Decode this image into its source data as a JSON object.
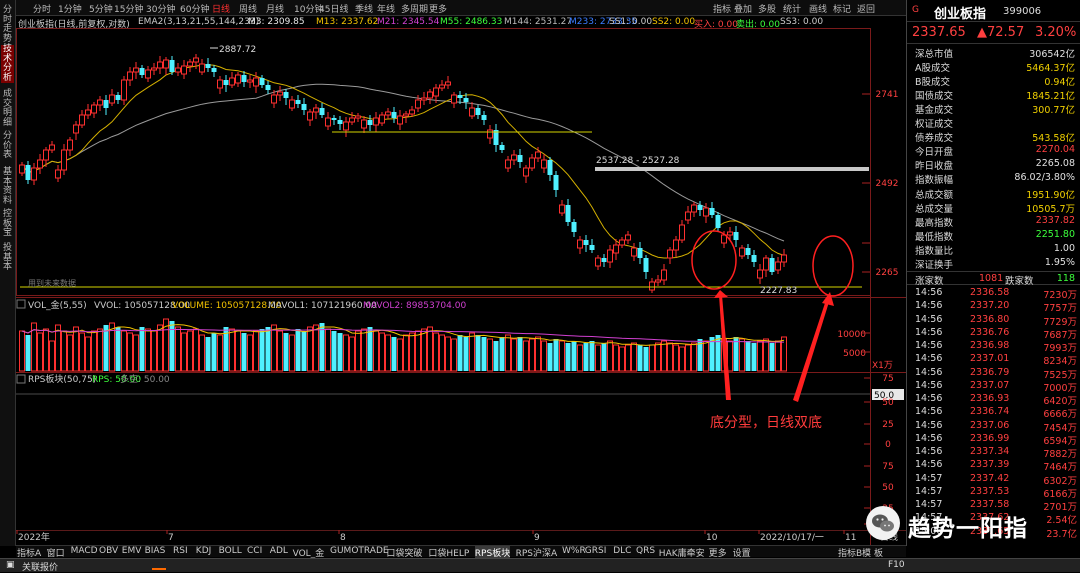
{
  "app": {
    "left_tabs": [
      "分时走势",
      "技术分析",
      "成交明细",
      "分价表",
      "基本资料",
      "控板宝",
      "投基本"
    ]
  },
  "toolbar": {
    "periods": [
      "分时",
      "1分钟",
      "5分钟",
      "15分钟",
      "30分钟",
      "60分钟",
      "日线",
      "周线",
      "月线",
      "10分钟",
      "45日线",
      "季线",
      "年线",
      "多周期",
      "更多"
    ],
    "active_period": "日线",
    "right_buttons": [
      "指标",
      "叠加",
      "多股",
      "统计",
      "画线",
      "标记",
      "返回"
    ]
  },
  "indicators": {
    "main_title": "创业板指(日线,前复权,对数)",
    "ema_label": "EMA2(3,13,21,55,144,233)",
    "m3": "M3: 2309.85",
    "m13": "M13: 2337.62",
    "m21": "M21: 2345.54",
    "m55": "M55: 2486.33",
    "m144": "M144: 2531.27",
    "m233": "M233: 2733.35",
    "ss1": "SS1: 0.00",
    "ss2": "SS2: 0.00",
    "buy": "买入: 0.00",
    "sell": "卖出: 0.00",
    "ss3": "SS3: 0.00"
  },
  "chart_labels": {
    "high": "2887.72",
    "gap": "2537.28 - 2527.28",
    "low": "2227.83",
    "future": "用到未来数据",
    "price_ticks": [
      "2741",
      "2492",
      "2265"
    ],
    "vol_title": "VOL_金(5,55)",
    "vvol": "VVOL: 105057128.00",
    "volume": "VOLUME: 105057128.00",
    "mavol1": "MAVOL1: 107121960.00",
    "mavol2": "MAVOL2: 89853704.00",
    "vol_ticks": [
      "10000",
      "5000"
    ],
    "vol_unit": "X1万",
    "rps_title": "RPS板块(50,75)",
    "rps": "RPS: 50.00",
    "rps_ms": "多空: 50.00",
    "rps_box": "50.0",
    "rps_ticks": [
      "75",
      "50",
      "25",
      "0",
      "75",
      "50",
      "25",
      "0"
    ],
    "dates": [
      "2022年",
      "7",
      "8",
      "9",
      "10",
      "2022/10/17/一",
      "11"
    ],
    "date_right": "日线"
  },
  "annotation": {
    "text": "底分型，日线双底"
  },
  "watermark": {
    "text": "趋势一阳指"
  },
  "quote": {
    "flag": "G",
    "name": "创业板指",
    "code": "399006",
    "price": "2337.65",
    "change": "▲72.57",
    "change_pct": "3.20%",
    "rows": [
      {
        "label": "深总市值",
        "value": "306542亿",
        "color": "#e0e0e0"
      },
      {
        "label": "A股成交",
        "value": "5464.37亿",
        "color": "#f0d000"
      },
      {
        "label": "B股成交",
        "value": "0.94亿",
        "color": "#f0d000"
      },
      {
        "label": "国债成交",
        "value": "1845.21亿",
        "color": "#f0d000"
      },
      {
        "label": "基金成交",
        "value": "300.77亿",
        "color": "#f0d000"
      },
      {
        "label": "权证成交",
        "value": "",
        "color": "#f0d000"
      },
      {
        "label": "债券成交",
        "value": "543.58亿",
        "color": "#f0d000"
      },
      {
        "label": "今日开盘",
        "value": "2270.04",
        "color": "#ff4040"
      },
      {
        "label": "昨日收盘",
        "value": "2265.08",
        "color": "#e0e0e0"
      },
      {
        "label": "指数振幅",
        "value": "86.02/3.80%",
        "color": "#e0e0e0"
      },
      {
        "label": "总成交额",
        "value": "1951.90亿",
        "color": "#f0d000"
      },
      {
        "label": "总成交量",
        "value": "10505.7万",
        "color": "#f0d000"
      },
      {
        "label": "最高指数",
        "value": "2337.82",
        "color": "#ff4040"
      },
      {
        "label": "最低指数",
        "value": "2251.80",
        "color": "#3cff3c"
      },
      {
        "label": "指数量比",
        "value": "1.00",
        "color": "#e0e0e0"
      },
      {
        "label": "深证换手",
        "value": "1.95%",
        "color": "#e0e0e0"
      }
    ],
    "updown": {
      "up_label": "涨家数",
      "up": "1081",
      "down_label": "跌家数",
      "down": "118"
    }
  },
  "ticks": [
    {
      "t": "14:56",
      "p": "2336.58",
      "q": "7230万"
    },
    {
      "t": "14:56",
      "p": "2337.20",
      "q": "7757万"
    },
    {
      "t": "14:56",
      "p": "2336.80",
      "q": "7729万"
    },
    {
      "t": "14:56",
      "p": "2336.76",
      "q": "7687万"
    },
    {
      "t": "14:56",
      "p": "2336.98",
      "q": "7993万"
    },
    {
      "t": "14:56",
      "p": "2337.01",
      "q": "8234万"
    },
    {
      "t": "14:56",
      "p": "2336.79",
      "q": "7525万"
    },
    {
      "t": "14:56",
      "p": "2337.07",
      "q": "7000万"
    },
    {
      "t": "14:56",
      "p": "2336.93",
      "q": "6420万"
    },
    {
      "t": "14:56",
      "p": "2336.74",
      "q": "6666万"
    },
    {
      "t": "14:56",
      "p": "2337.06",
      "q": "7454万"
    },
    {
      "t": "14:56",
      "p": "2336.99",
      "q": "6594万"
    },
    {
      "t": "14:56",
      "p": "2337.34",
      "q": "7882万"
    },
    {
      "t": "14:56",
      "p": "2337.39",
      "q": "7464万"
    },
    {
      "t": "14:57",
      "p": "2337.42",
      "q": "6302万"
    },
    {
      "t": "14:57",
      "p": "2337.53",
      "q": "6166万"
    },
    {
      "t": "14:57",
      "p": "2337.58",
      "q": "2701万"
    },
    {
      "t": "14:57",
      "p": "2337.62",
      "q": "2.54亿"
    },
    {
      "t": "15:00",
      "p": "2337.65",
      "q": "23.7亿"
    }
  ],
  "bottom_tabs": [
    "指标A",
    "窗口",
    "MACD",
    "OBV",
    "EMV",
    "BIAS",
    "RSI",
    "KDJ",
    "BOLL",
    "CCI",
    "ADL",
    "VOL_金",
    "GUMOTRADE",
    "口袋突破",
    "口袋HELP",
    "RPS板块",
    "RPS沪深A",
    "W%R",
    "GRSI",
    "DLC",
    "QRS",
    "HAK庸牵安",
    "更多",
    "设置"
  ],
  "bottom_active": "RPS板块",
  "bottom_right": [
    "指标B",
    "模",
    "板"
  ],
  "status": {
    "left": "关联报价",
    "right": "F10"
  }
}
